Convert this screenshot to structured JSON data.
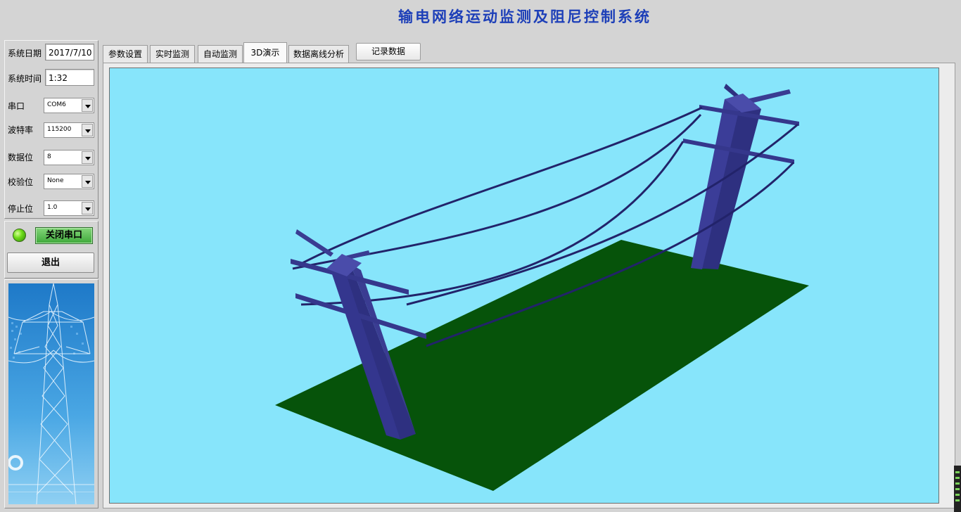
{
  "app": {
    "title": "输电网络运动监测及阻尼控制系统"
  },
  "sidebar": {
    "date_label": "系统日期",
    "date_value": "2017/7/10",
    "time_label": "系统时间",
    "time_value": "1:32",
    "serial_label": "串口",
    "serial_value": "COM6",
    "baud_label": "波特率",
    "baud_value": "115200",
    "databits_label": "数据位",
    "databits_value": "8",
    "parity_label": "校验位",
    "parity_value": "None",
    "stopbits_label": "停止位",
    "stopbits_value": "1.0",
    "close_port_label": "关闭串口",
    "exit_label": "退出",
    "led_status": "on",
    "led_color": "#6fdc1a"
  },
  "tabs": [
    {
      "label": "参数设置"
    },
    {
      "label": "实时监测"
    },
    {
      "label": "自动监测"
    },
    {
      "label": "3D演示",
      "active": true
    },
    {
      "label": "数据离线分析"
    }
  ],
  "record_button": "记录数据",
  "scene": {
    "sky_color": "#87e5fb",
    "ground_color": "#06530a",
    "tower_color": "#33348a",
    "wire_color": "#22236a",
    "content": "two-utility-poles-with-three-sagging-power-lines"
  }
}
